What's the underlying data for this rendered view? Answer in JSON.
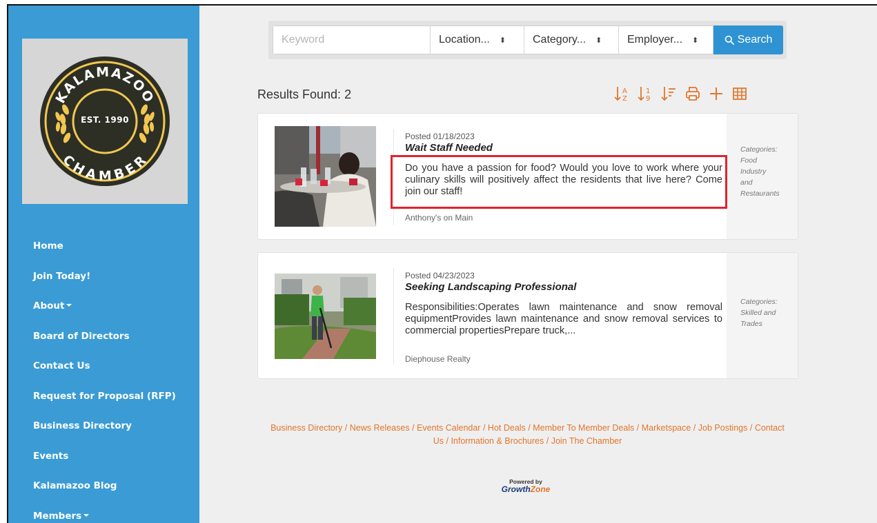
{
  "brand": {
    "logo_top_text": "KALAMAZOO",
    "logo_bottom_text": "CHAMBER",
    "logo_est_text": "EST. 1990"
  },
  "sidebar": {
    "items": [
      {
        "label": "Home"
      },
      {
        "label": "Join Today!"
      },
      {
        "label": "About",
        "dropdown": true
      },
      {
        "label": "Board of Directors"
      },
      {
        "label": "Contact Us"
      },
      {
        "label": "Request for Proposal (RFP)"
      },
      {
        "label": "Business Directory"
      },
      {
        "label": "Events"
      },
      {
        "label": "Kalamazoo Blog"
      },
      {
        "label": "Members",
        "dropdown": true
      }
    ]
  },
  "search": {
    "keyword_placeholder": "Keyword",
    "location_label": "Location...",
    "category_label": "Category...",
    "employer_label": "Employer...",
    "button_label": "Search",
    "select_icon": "updown-arrows-icon",
    "button_icon": "search-icon"
  },
  "results": {
    "label": "Results Found:",
    "count": "2"
  },
  "toolbar": {
    "icons": [
      "sort-alpha-icon",
      "sort-numeric-icon",
      "sort-lines-icon",
      "print-icon",
      "plus-icon",
      "grid-icon"
    ],
    "color": "#e2762c"
  },
  "jobs": [
    {
      "posted": "Posted 01/18/2023",
      "title": "Wait Staff Needed",
      "description": "Do you have a passion for food? Would you love to work where your culinary skills will positively affect the residents that live here? Come join our staff!",
      "employer": "Anthony's on Main",
      "categories_label": "Categories:",
      "categories": [
        "Food",
        "Industry",
        "and",
        "Restaurants"
      ],
      "highlighted": true
    },
    {
      "posted": "Posted 04/23/2023",
      "title": "Seeking Landscaping Professional",
      "description": "Responsibilities:Operates lawn maintenance and snow removal equipmentProvides lawn maintenance and snow removal services to commercial propertiesPrepare truck,...",
      "employer": "Diephouse Realty",
      "categories_label": "Categories:",
      "categories": [
        "Skilled and",
        "Trades"
      ],
      "highlighted": false
    }
  ],
  "footer": {
    "links": [
      "Business Directory",
      "News Releases",
      "Events Calendar",
      "Hot Deals",
      "Member To Member Deals",
      "Marketspace",
      "Job Postings",
      "Contact Us",
      "Information & Brochures",
      "Join The Chamber"
    ],
    "separator": "/",
    "powered_by": "Powered by",
    "growthzone_a": "Growth",
    "growthzone_b": "Zone"
  },
  "colors": {
    "sidebar_bg": "#3a9bd5",
    "accent": "#e2762c",
    "search_button": "#2f93d3",
    "highlight_border": "#e0232c",
    "logo_dark": "#2d2f25",
    "logo_gold": "#f2c750"
  }
}
